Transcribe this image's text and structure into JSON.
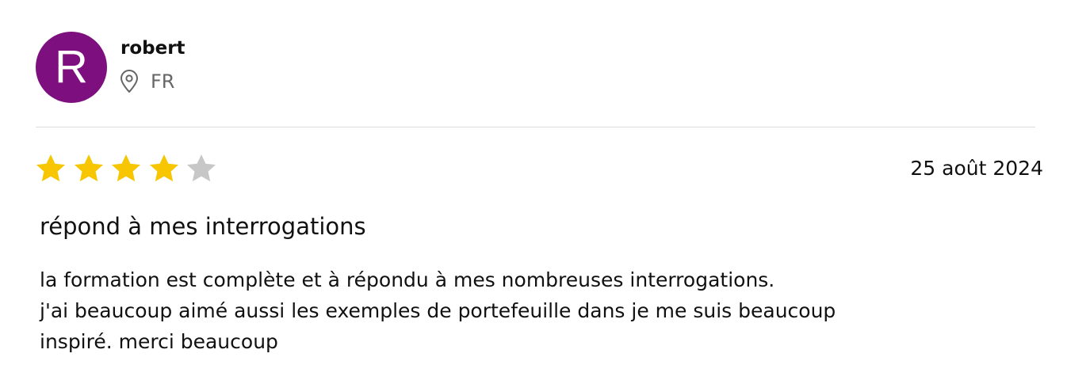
{
  "reviewer": {
    "initial": "R",
    "name": "robert",
    "country": "FR",
    "avatar_color": "#7e0f7e"
  },
  "rating": {
    "value": 4,
    "max": 5,
    "filled_color": "#f7c600",
    "empty_color": "#c7c7c7"
  },
  "review": {
    "date": "25 août 2024",
    "title": "répond à mes interrogations",
    "body": "la formation est complète et à répondu à mes nombreuses interrogations.\nj'ai beaucoup aimé aussi les exemples de portefeuille dans je me suis beaucoup\ninspiré. merci beaucoup"
  },
  "icons": {
    "location": "location-pin-icon",
    "star": "star-icon"
  }
}
